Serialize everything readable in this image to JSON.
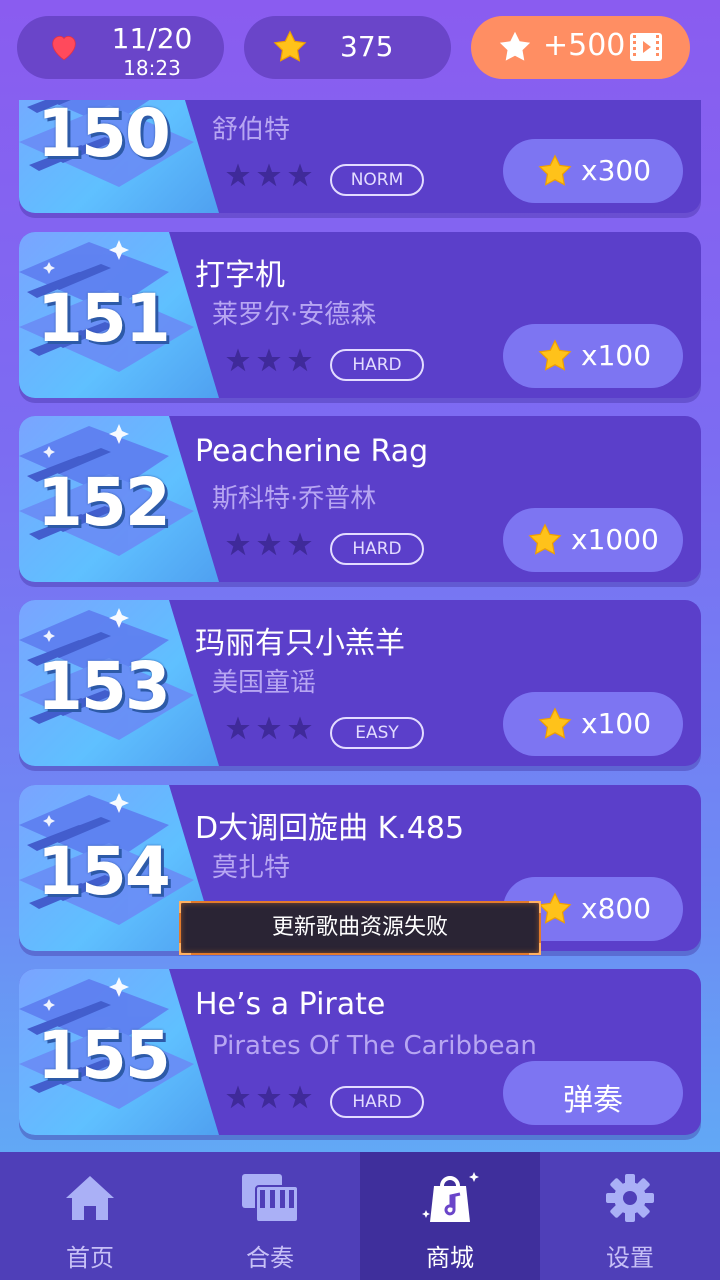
{
  "status": {
    "lives": "11/20",
    "lives_timer": "18:23",
    "star_balance": "375",
    "reward_label": "+500"
  },
  "songs": [
    {
      "number": "150",
      "title": "",
      "artist": "舒伯特",
      "difficulty": "NORM",
      "price": "x300",
      "difficulty_stars": 3
    },
    {
      "number": "151",
      "title": "打字机",
      "artist": "莱罗尔·安德森",
      "difficulty": "HARD",
      "price": "x100",
      "difficulty_stars": 3
    },
    {
      "number": "152",
      "title": "Peacherine Rag",
      "artist": "斯科特·乔普林",
      "difficulty": "HARD",
      "price": "x1000",
      "difficulty_stars": 3
    },
    {
      "number": "153",
      "title": "玛丽有只小羔羊",
      "artist": "美国童谣",
      "difficulty": "EASY",
      "price": "x100",
      "difficulty_stars": 3
    },
    {
      "number": "154",
      "title": "D大调回旋曲 K.485",
      "artist": "莫扎特",
      "difficulty": "",
      "price": "x800",
      "difficulty_stars": 3
    },
    {
      "number": "155",
      "title": "He’s a Pirate",
      "artist": "Pirates Of The Caribbean",
      "difficulty": "HARD",
      "action": "弹奏",
      "difficulty_stars": 3
    }
  ],
  "toast": "更新歌曲资源失败",
  "nav": [
    {
      "label": "首页",
      "icon": "home-icon"
    },
    {
      "label": "合奏",
      "icon": "piano-icon"
    },
    {
      "label": "商城",
      "icon": "shop-bag-icon",
      "active": true
    },
    {
      "label": "设置",
      "icon": "gear-icon"
    }
  ],
  "colors": {
    "accent": "#ff8e63",
    "card": "#5b3fca",
    "nav": "#4f3fb8",
    "toast_border": "#e27a2c"
  }
}
